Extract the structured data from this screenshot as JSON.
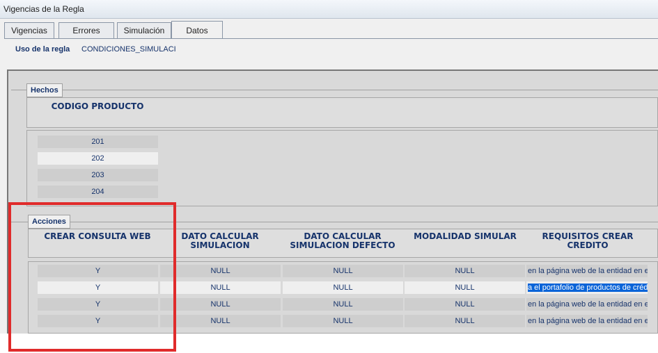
{
  "window": {
    "title": "Vigencias de la Regla"
  },
  "tabs": [
    {
      "label": "Vigencias"
    },
    {
      "label": "Errores"
    },
    {
      "label": "Simulación"
    },
    {
      "label": "Datos"
    }
  ],
  "uso": {
    "label": "Uso de la regla",
    "value": "CONDICIONES_SIMULACI"
  },
  "hechos": {
    "title": "Hechos",
    "column": "CODIGO PRODUCTO",
    "rows": [
      "201",
      "202",
      "203",
      "204"
    ]
  },
  "acciones": {
    "title": "Acciones",
    "columns": [
      {
        "line1": "CREAR CONSULTA WEB",
        "line2": ""
      },
      {
        "line1": "DATO CALCULAR",
        "line2": "SIMULACION"
      },
      {
        "line1": "DATO CALCULAR",
        "line2": "SIMULACION DEFECTO"
      },
      {
        "line1": "MODALIDAD SIMULAR",
        "line2": ""
      },
      {
        "line1": "REQUISITOS CREAR",
        "line2": "CREDITO"
      }
    ],
    "rows": [
      {
        "c1": "Y",
        "c2": "NULL",
        "c3": "NULL",
        "c4": "NULL",
        "c5": "en la página web de la entidad en el"
      },
      {
        "c1": "Y",
        "c2": "NULL",
        "c3": "NULL",
        "c4": "NULL",
        "c5": "a el portafolio de productos de crédito"
      },
      {
        "c1": "Y",
        "c2": "NULL",
        "c3": "NULL",
        "c4": "NULL",
        "c5": "en la página web de la entidad en el"
      },
      {
        "c1": "Y",
        "c2": "NULL",
        "c3": "NULL",
        "c4": "NULL",
        "c5": "en la página web de la entidad en el"
      }
    ]
  },
  "colors": {
    "highlight_box": "#e02b2b",
    "selection": "#0a64d8",
    "text": "#16336b"
  }
}
